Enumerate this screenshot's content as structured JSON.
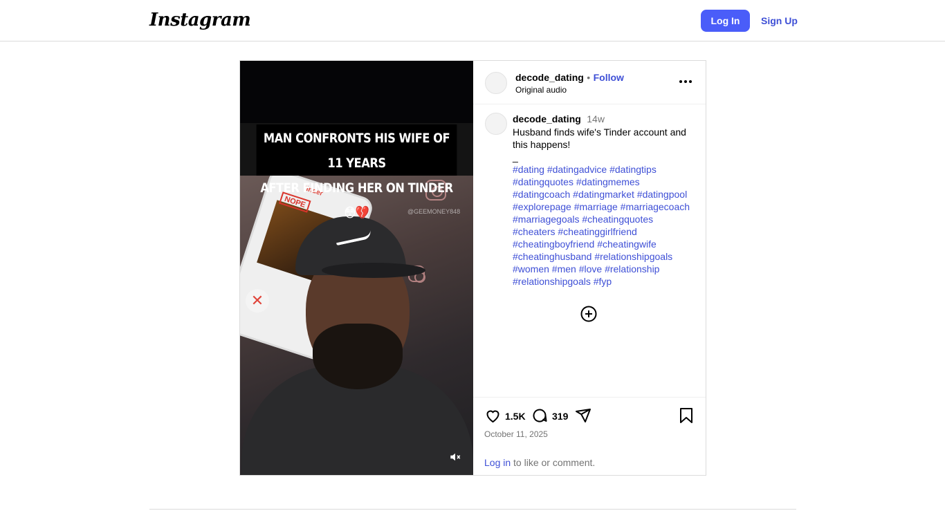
{
  "header": {
    "logo_text": "Instagram",
    "login_label": "Log In",
    "signup_label": "Sign Up"
  },
  "media": {
    "overlay_line1": "MAN CONFRONTS HIS WIFE OF 11 YEARS",
    "overlay_line2": "AFTER FINDING HER ON TINDER 😳💔",
    "watermark": "@GEEMONEY848",
    "nope_label": "NOPE",
    "tinder_label": "tinder"
  },
  "post_header": {
    "username": "decode_dating",
    "separator": "•",
    "follow_label": "Follow",
    "audio": "Original audio"
  },
  "caption": {
    "username": "decode_dating",
    "time": "14w",
    "text_line1": "Husband finds wife's Tinder account and",
    "text_line2": "this happens!",
    "divider": "_",
    "hashtags": [
      "#dating #datingadvice #datingtips",
      "#datingquotes #datingmemes",
      "#datingcoach #datingmarket #datingpool",
      "#explorepage #marriage #marriagecoach",
      "#marriagegoals #cheatingquotes",
      "#cheaters #cheatinggirlfriend",
      "#cheatingboyfriend #cheatingwife",
      "#cheatinghusband #relationshipgoals",
      "#women #men #love #relationship",
      "#relationshipgoals #fyp"
    ]
  },
  "actions": {
    "likes": "1.5K",
    "comments": "319",
    "date": "October 11, 2025",
    "login_link": "Log in",
    "login_suffix": " to like or comment."
  },
  "colors": {
    "accent": "#4a5df9",
    "link": "#3e4fd6",
    "muted": "#737373",
    "border": "#dbdbdb"
  }
}
